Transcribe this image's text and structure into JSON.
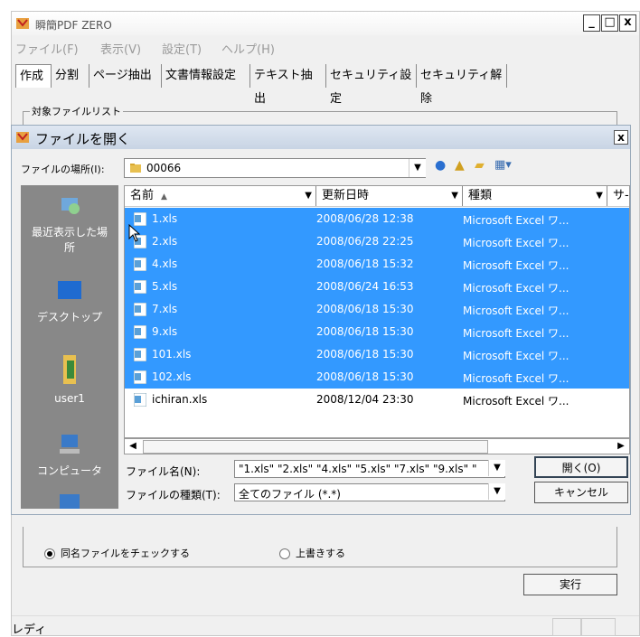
{
  "app": {
    "title": "瞬簡PDF ZERO",
    "min": "_",
    "max": "□",
    "close": "x"
  },
  "menu": [
    "ファイル(F)",
    "表示(V)",
    "設定(T)",
    "ヘルプ(H)"
  ],
  "tabs": [
    "作成",
    "分割",
    "ページ抽出",
    "文書情報設定",
    "テキスト抽出",
    "セキュリティ設定",
    "セキュリティ解除"
  ],
  "target_group_label": "対象ファイルリスト",
  "dialog": {
    "title": "ファイルを開く",
    "close": "x",
    "lookin_label": "ファイルの場所(I):",
    "lookin_value": "00066",
    "places": [
      "最近表示した場所",
      "デスクトップ",
      "user1",
      "コンピュータ"
    ],
    "columns": [
      "名前",
      "更新日時",
      "種類",
      "サ-"
    ],
    "files": [
      {
        "name": "1.xls",
        "date": "2008/06/28 12:38",
        "type": "Microsoft Excel ワ...",
        "selected": true
      },
      {
        "name": "2.xls",
        "date": "2008/06/28 22:25",
        "type": "Microsoft Excel ワ...",
        "selected": true
      },
      {
        "name": "4.xls",
        "date": "2008/06/18 15:32",
        "type": "Microsoft Excel ワ...",
        "selected": true
      },
      {
        "name": "5.xls",
        "date": "2008/06/24 16:53",
        "type": "Microsoft Excel ワ...",
        "selected": true
      },
      {
        "name": "7.xls",
        "date": "2008/06/18 15:30",
        "type": "Microsoft Excel ワ...",
        "selected": true
      },
      {
        "name": "9.xls",
        "date": "2008/06/18 15:30",
        "type": "Microsoft Excel ワ...",
        "selected": true
      },
      {
        "name": "101.xls",
        "date": "2008/06/18 15:30",
        "type": "Microsoft Excel ワ...",
        "selected": true
      },
      {
        "name": "102.xls",
        "date": "2008/06/18 15:30",
        "type": "Microsoft Excel ワ...",
        "selected": true
      },
      {
        "name": "ichiran.xls",
        "date": "2008/12/04 23:30",
        "type": "Microsoft Excel ワ...",
        "selected": false
      }
    ],
    "filename_label": "ファイル名(N):",
    "filename_value": "\"1.xls\" \"2.xls\" \"4.xls\" \"5.xls\" \"7.xls\" \"9.xls\" \"",
    "filetype_label": "ファイルの種類(T):",
    "filetype_value": "全てのファイル (*.*)",
    "open_label": "開く(O)",
    "cancel_label": "キャンセル"
  },
  "options": {
    "radio_check": "同名ファイルをチェックする",
    "radio_overwrite": "上書きする",
    "run_label": "実行"
  },
  "status": "レディ",
  "colors": {
    "selection": "#3399ff",
    "places_bg": "#888888",
    "excel_icon": "#5aa0d8"
  }
}
